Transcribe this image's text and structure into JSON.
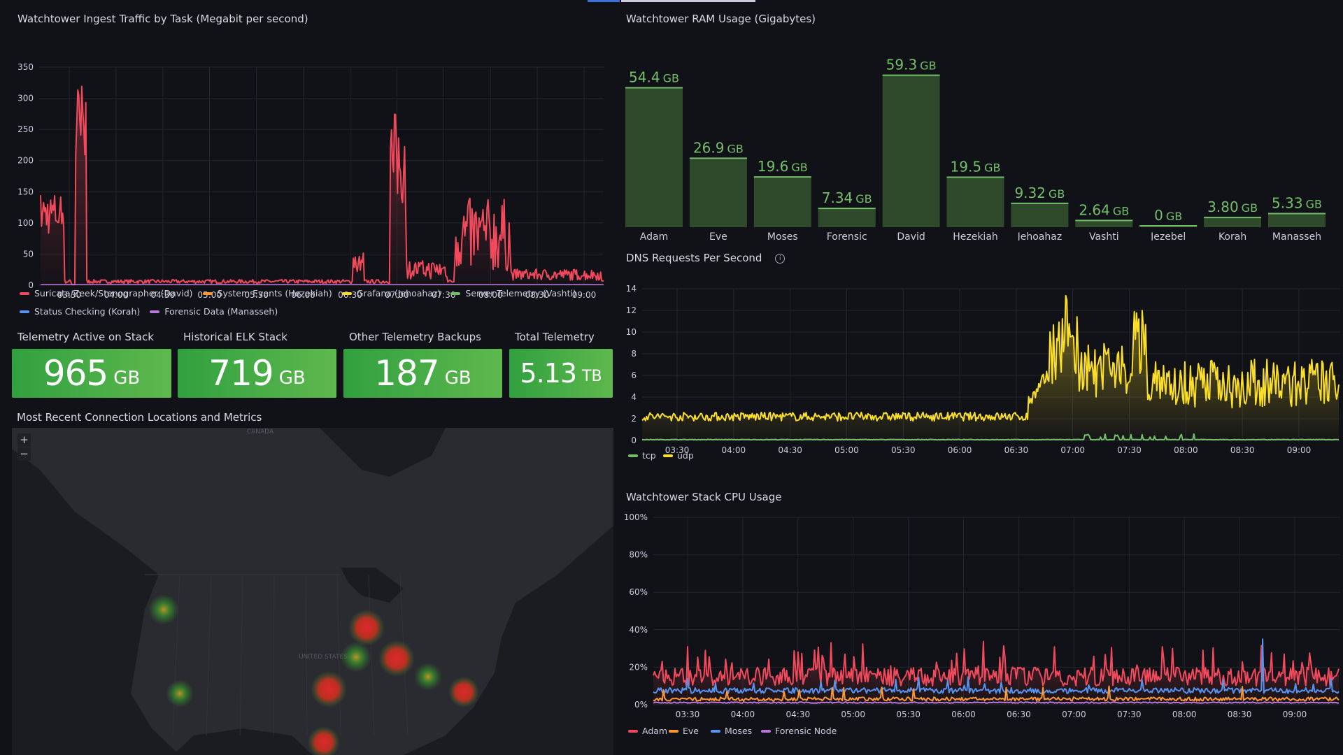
{
  "colors": {
    "red": "#f2495c",
    "orange": "#ff9830",
    "yellow": "#fade2a",
    "green": "#73bf69",
    "blue": "#5794f2",
    "purple": "#b877d9",
    "stat_green": "#56b04a",
    "bar_fill": "#2e4a2b",
    "bar_line": "#73bf69"
  },
  "ingest": {
    "title": "Watchtower Ingest Traffic by Task (Megabit per second)",
    "y_ticks": [
      "350",
      "300",
      "250",
      "200",
      "150",
      "100",
      "50",
      "0"
    ],
    "x_ticks": [
      "03:30",
      "04:00",
      "04:30",
      "05:00",
      "05:30",
      "06:00",
      "06:30",
      "07:00",
      "07:30",
      "08:00",
      "08:30",
      "09:00"
    ],
    "legend": [
      {
        "label": "Suricata/Zeek/Stenographer (David)",
        "color": "red"
      },
      {
        "label": "System Events (Hezekiah)",
        "color": "orange"
      },
      {
        "label": "Grafana (Jehoahaz)",
        "color": "yellow"
      },
      {
        "label": "Server Telemetry (Vashti)",
        "color": "green"
      },
      {
        "label": "Status Checking (Korah)",
        "color": "blue"
      },
      {
        "label": "Forensic Data (Manasseh)",
        "color": "purple"
      }
    ]
  },
  "ram": {
    "title": "Watchtower RAM Usage (Gigabytes)",
    "unit": "GB",
    "bars": [
      {
        "name": "Adam",
        "value": "54.4"
      },
      {
        "name": "Eve",
        "value": "26.9"
      },
      {
        "name": "Moses",
        "value": "19.6"
      },
      {
        "name": "Forensic",
        "value": "7.34"
      },
      {
        "name": "David",
        "value": "59.3"
      },
      {
        "name": "Hezekiah",
        "value": "19.5"
      },
      {
        "name": "Jehoahaz",
        "value": "9.32"
      },
      {
        "name": "Vashti",
        "value": "2.64"
      },
      {
        "name": "Jezebel",
        "value": "0"
      },
      {
        "name": "Korah",
        "value": "3.80"
      },
      {
        "name": "Manasseh",
        "value": "5.33"
      }
    ]
  },
  "dns": {
    "title": "DNS Requests Per Second",
    "y_ticks": [
      "14",
      "12",
      "10",
      "8",
      "6",
      "4",
      "2",
      "0"
    ],
    "x_ticks": [
      "03:30",
      "04:00",
      "04:30",
      "05:00",
      "05:30",
      "06:00",
      "06:30",
      "07:00",
      "07:30",
      "08:00",
      "08:30",
      "09:00"
    ],
    "legend": [
      {
        "label": "tcp",
        "color": "green"
      },
      {
        "label": "udp",
        "color": "yellow"
      }
    ]
  },
  "cpu": {
    "title": "Watchtower Stack CPU Usage",
    "y_ticks": [
      "100%",
      "80%",
      "60%",
      "40%",
      "20%",
      "0%"
    ],
    "x_ticks": [
      "03:30",
      "04:00",
      "04:30",
      "05:00",
      "05:30",
      "06:00",
      "06:30",
      "07:00",
      "07:30",
      "08:00",
      "08:30",
      "09:00"
    ],
    "legend": [
      {
        "label": "Adam",
        "color": "red"
      },
      {
        "label": "Eve",
        "color": "orange"
      },
      {
        "label": "Moses",
        "color": "blue"
      },
      {
        "label": "Forensic Node",
        "color": "purple"
      }
    ]
  },
  "stats": [
    {
      "title": "Telemetry Active on Stack",
      "value": "965",
      "unit": "GB"
    },
    {
      "title": "Historical ELK Stack",
      "value": "719",
      "unit": "GB"
    },
    {
      "title": "Other Telemetry Backups",
      "value": "187",
      "unit": "GB"
    },
    {
      "title": "Total Telemetry",
      "value": "5.13",
      "unit": "TB"
    }
  ],
  "map": {
    "title": "Most Recent Connection Locations and Metrics",
    "zoom_in": "+",
    "zoom_out": "−",
    "label_canada": "CANADA",
    "label_us": "UNITED STATES"
  }
}
